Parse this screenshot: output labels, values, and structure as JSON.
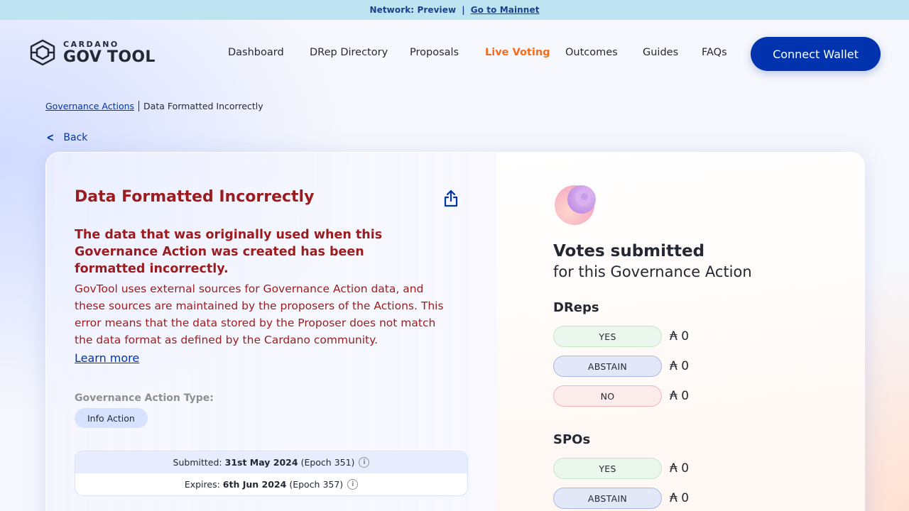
{
  "banner": {
    "network": "Network: Preview",
    "separator": "|",
    "mainnet_link": "Go to Mainnet"
  },
  "logo": {
    "small": "CARDANO",
    "big": "GOV TOOL",
    "icon": "hexagon-logo-icon"
  },
  "nav": {
    "items": [
      {
        "label": "Dashboard"
      },
      {
        "label": "DRep Directory"
      },
      {
        "label": "Proposals"
      },
      {
        "label": "Live Voting",
        "active": true
      },
      {
        "label": "Outcomes"
      },
      {
        "label": "Guides"
      },
      {
        "label": "FAQs"
      }
    ],
    "connect_label": "Connect Wallet"
  },
  "breadcrumb": {
    "parent": "Governance Actions",
    "current": "Data Formatted Incorrectly"
  },
  "back_label": "Back",
  "action": {
    "title": "Data Formatted Incorrectly",
    "error_heading": "The data that was originally used when this Governance Action was created has been formatted incorrectly.",
    "error_body": "GovTool uses external sources for Governance Action data, and these sources are maintained by the proposers of the Actions. This error means that the data stored by the Proposer does not match the data format as defined by the Cardano community.",
    "learn_more": "Learn more",
    "type_label": "Governance Action Type:",
    "type_value": "Info Action",
    "submitted": {
      "label": "Submitted:",
      "date": "31st May 2024",
      "epoch": "(Epoch 351)"
    },
    "expires": {
      "label": "Expires:",
      "date": "6th Jun 2024",
      "epoch": "(Epoch 357)"
    }
  },
  "votes": {
    "title": "Votes submitted",
    "subtitle": "for this Governance Action",
    "dreps": {
      "title": "DReps",
      "yes": {
        "label": "YES",
        "amount": "₳ 0"
      },
      "abstain": {
        "label": "ABSTAIN",
        "amount": "₳ 0"
      },
      "no": {
        "label": "NO",
        "amount": "₳ 0"
      }
    },
    "spos": {
      "title": "SPOs",
      "yes": {
        "label": "YES",
        "amount": "₳ 0"
      },
      "abstain": {
        "label": "ABSTAIN",
        "amount": "₳ 0"
      }
    }
  },
  "colors": {
    "primary": "#0033ad",
    "active_nav": "#f96a1a",
    "error": "#9b1c1f",
    "banner": "#bee3f1"
  }
}
